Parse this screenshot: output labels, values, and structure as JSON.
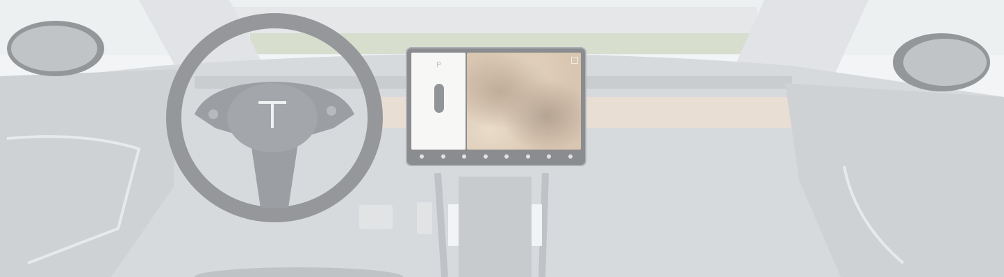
{
  "scene": {
    "subject": "car-interior-dashboard",
    "display": {
      "gear_indicator": "P"
    },
    "colors": {
      "dash_dark": "#4a4f56",
      "wood_trim": "#c9a78a",
      "glass_sky": "#d9dde0",
      "map_terrain": "#b99772"
    }
  }
}
